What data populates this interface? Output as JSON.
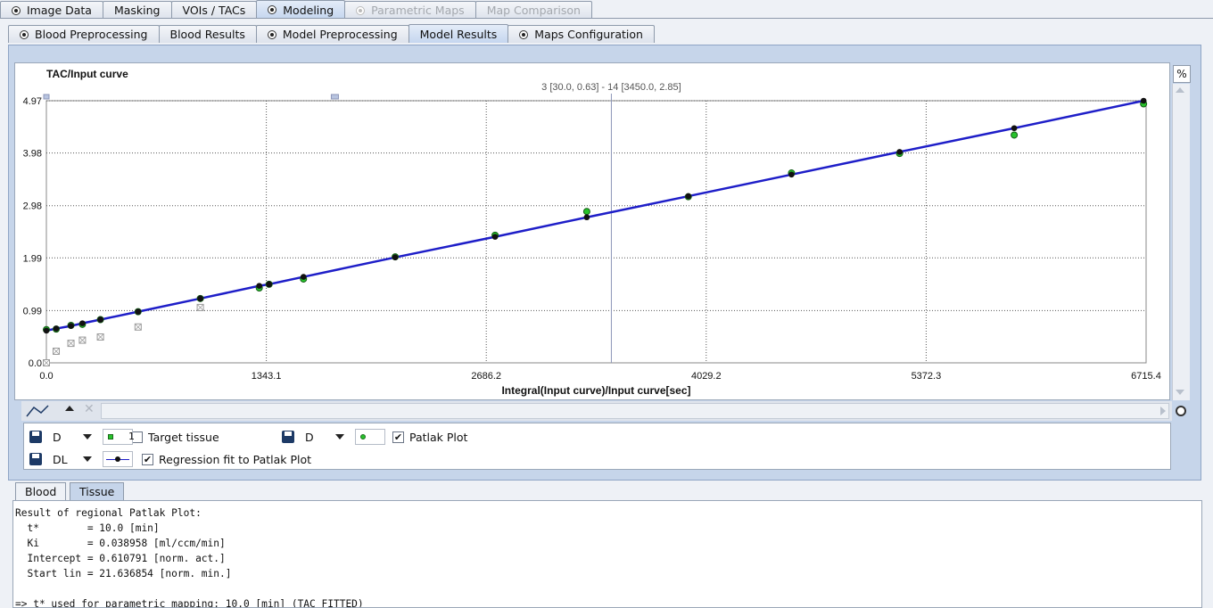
{
  "top_tabs": [
    {
      "label": "Image Data",
      "radio": true,
      "state": "normal"
    },
    {
      "label": "Masking",
      "radio": false,
      "state": "normal"
    },
    {
      "label": "VOIs / TACs",
      "radio": false,
      "state": "normal"
    },
    {
      "label": "Modeling",
      "radio": true,
      "state": "active"
    },
    {
      "label": "Parametric Maps",
      "radio": true,
      "state": "disabled"
    },
    {
      "label": "Map Comparison",
      "radio": false,
      "state": "disabled"
    }
  ],
  "sub_tabs": [
    {
      "label": "Blood Preprocessing",
      "radio": true,
      "state": "normal"
    },
    {
      "label": "Blood Results",
      "radio": false,
      "state": "normal"
    },
    {
      "label": "Model Preprocessing",
      "radio": true,
      "state": "normal"
    },
    {
      "label": "Model Results",
      "radio": false,
      "state": "active"
    },
    {
      "label": "Maps Configuration",
      "radio": true,
      "state": "normal"
    }
  ],
  "plot": {
    "percent_button": "%",
    "cursor_readout": "3 [30.0, 0.63] - 14 [3450.0, 2.85]"
  },
  "chart_data": {
    "type": "scatter",
    "title": "TAC/Input curve",
    "xlabel": "Integral(Input curve)/Input curve[sec]",
    "ylabel": "",
    "xlim": [
      0,
      6715.4
    ],
    "ylim": [
      0,
      4.97
    ],
    "x_ticks": [
      "0.0",
      "1343.1",
      "2686.2",
      "4029.2",
      "5372.3",
      "6715.4"
    ],
    "y_ticks": [
      "0.0",
      "0.99",
      "1.99",
      "2.98",
      "3.98",
      "4.97"
    ],
    "cursor_x": 3450.0,
    "grid": true,
    "series": [
      {
        "name": "Target tissue",
        "marker": "crossed-square",
        "color": "#9a9a9a",
        "x": [
          0,
          60,
          150,
          220,
          330,
          560,
          940
        ],
        "y": [
          0.0,
          0.22,
          0.37,
          0.43,
          0.49,
          0.68,
          1.05
        ]
      },
      {
        "name": "Patlak Plot",
        "marker": "circle",
        "color": "#27c22b",
        "x": [
          0,
          60,
          150,
          220,
          330,
          560,
          940,
          1300,
          1360,
          1570,
          2130,
          2740,
          3300,
          3920,
          4550,
          5210,
          5910,
          6700
        ],
        "y": [
          0.63,
          0.64,
          0.71,
          0.73,
          0.82,
          0.97,
          1.22,
          1.42,
          1.49,
          1.59,
          2.01,
          2.42,
          2.87,
          3.15,
          3.6,
          3.97,
          4.32,
          4.91
        ]
      },
      {
        "name": "Regression fit to Patlak Plot",
        "marker": "dot-line",
        "color": "#1e1ec8",
        "x": [
          0,
          60,
          150,
          220,
          330,
          560,
          940,
          1300,
          1360,
          1570,
          2130,
          2740,
          3300,
          3920,
          4550,
          5210,
          5910,
          6700
        ],
        "y": [
          0.611,
          0.65,
          0.7,
          0.75,
          0.82,
          0.97,
          1.22,
          1.46,
          1.49,
          1.63,
          2.0,
          2.39,
          2.76,
          3.16,
          3.57,
          4.0,
          4.45,
          4.97
        ]
      }
    ]
  },
  "legend": {
    "row1": [
      {
        "style_letter": "D",
        "extra": "1",
        "checked": false,
        "label": "Target tissue"
      },
      {
        "style_letter": "D",
        "extra": "",
        "checked": true,
        "label": "Patlak Plot"
      }
    ],
    "row2": [
      {
        "style_letter": "DL",
        "extra": "",
        "checked": true,
        "label": "Regression fit to Patlak Plot"
      }
    ]
  },
  "bottom_tabs": [
    "Blood",
    "Tissue"
  ],
  "result_text": [
    "Result of regional Patlak Plot:",
    "  t*        = 10.0 [min]",
    "  Ki        = 0.038958 [ml/ccm/min]",
    "  Intercept = 0.610791 [norm. act.]",
    "  Start lin = 21.636854 [norm. min.]",
    "",
    "=> t* used for parametric mapping: 10.0 [min] (TAC FITTED)"
  ]
}
